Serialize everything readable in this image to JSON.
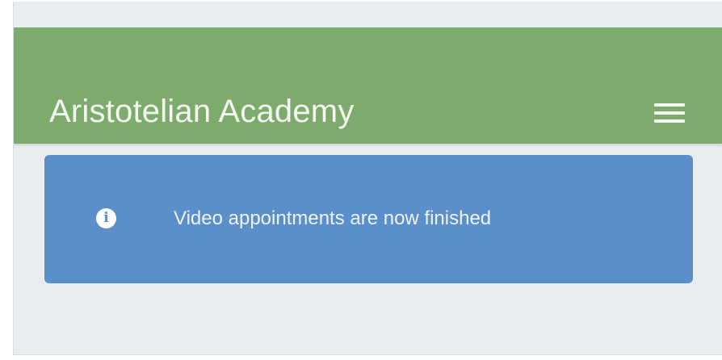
{
  "header": {
    "title": "Aristotelian Academy",
    "menu_icon": "hamburger-menu-icon"
  },
  "alert": {
    "icon": "info-icon",
    "icon_glyph": "i",
    "message": "Video appointments are now finished"
  },
  "colors": {
    "header_bg": "#7dab6c",
    "alert_bg": "#5b8fc9",
    "page_bg": "#eaedf0"
  }
}
